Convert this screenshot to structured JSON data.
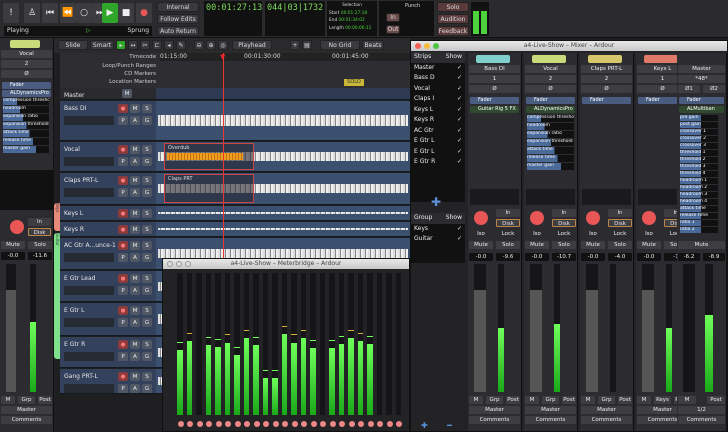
{
  "transport": {
    "status_left": "Playing",
    "status_right": "Sprung",
    "sync": "Internal",
    "follow_edits": "Follow Edits",
    "auto_return": "Auto Return",
    "icons": [
      "alert-icon",
      "metronome-icon",
      "goto-start-icon",
      "goto-prev-icon",
      "loop-icon",
      "goto-end-icon",
      "play-icon",
      "stop-icon",
      "record-icon"
    ]
  },
  "clocks": {
    "primary": "00:01:27:13",
    "secondary": "044|03|1732"
  },
  "selection": {
    "title": "Selection",
    "start_label": "Start",
    "start": "00:01:27:18",
    "end_label": "End",
    "end": "00:01:34:02",
    "length_label": "Length",
    "length": "00:00:06:11"
  },
  "punch": {
    "title": "Punch",
    "in": "In",
    "out": "Out"
  },
  "monitor": {
    "solo": "Solo",
    "audition": "Audition",
    "feedback": "Feedback"
  },
  "toolbar": {
    "edit_mode": "Slide",
    "tool_mode": "Smart",
    "edit_point": "Playhead",
    "grid": "No Grid",
    "beats": "Beats"
  },
  "ruler": {
    "rows": [
      "Timecode",
      "Loop/Punch Ranges",
      "CD Markers",
      "Location Markers"
    ],
    "ticks": [
      "01:15:00",
      "00:01:30:00",
      "00:01:45:00"
    ],
    "marker": "SOLO"
  },
  "editor_strip": {
    "name": "Vocal",
    "input": "2",
    "phase": "Ø",
    "plugins": [
      "Fader",
      "ALDynamicsPro"
    ],
    "params": [
      "compression threshold",
      "headroom",
      "expansion ratio",
      "expansion threshold",
      "attack time",
      "release time",
      "master gain"
    ],
    "in": "In",
    "disk": "Disk",
    "mute": "Mute",
    "solo": "Solo",
    "gain": "-0.0",
    "peak": "-11.6",
    "level": 0.55,
    "m": "M",
    "grp": "Grp",
    "post": "Post",
    "output": "Master",
    "comments": "Comments"
  },
  "tracks": [
    {
      "name": "Master",
      "type": "master"
    },
    {
      "name": "Bass DI",
      "h": 40
    },
    {
      "name": "Vocal",
      "h": 30,
      "region": "Overdub"
    },
    {
      "name": "Claps PRT-L",
      "h": 32,
      "region": "Claps PRT"
    },
    {
      "name": "Keys L",
      "h": 15,
      "small": true
    },
    {
      "name": "Keys R",
      "h": 15,
      "small": true
    },
    {
      "name": "AC Gtr A...unce-1",
      "h": 32
    },
    {
      "name": "E Gtr Lead",
      "h": 31
    },
    {
      "name": "E Gtr L",
      "h": 33
    },
    {
      "name": "E Gtr R",
      "h": 31
    },
    {
      "name": "Gang PRT-L",
      "h": 25
    }
  ],
  "groups_tabs": [
    "Keys",
    "Guitar"
  ],
  "track_buttons": {
    "m": "M",
    "s": "S",
    "p": "P",
    "a": "A",
    "g": "G"
  },
  "mixer": {
    "title": "a4-Live-Show – Mixer – Ardour",
    "strips_header": [
      "Strips",
      "Show"
    ],
    "strips_list": [
      "Master",
      "Bass D",
      "Vocal",
      "Claps I",
      "Keys L",
      "Keys R",
      "AC Gtr",
      "E Gtr L",
      "E Gtr L",
      "E Gtr R"
    ],
    "group_header": [
      "Group",
      "Show"
    ],
    "groups": [
      "Keys",
      "Guitar"
    ],
    "check": "✓",
    "strips": [
      {
        "name": "Bass DI",
        "color": "#7fd0cc",
        "input": "1",
        "plugins": [
          "Fader",
          "Guitar Rig 5 FX"
        ],
        "gain": "-0.0",
        "peak": "-9.6",
        "level": 0.5,
        "grp": "Grp",
        "output": "Master"
      },
      {
        "name": "Vocal",
        "color": "#c9da7a",
        "input": "2",
        "plugins": [
          "Fader",
          "ALDynamicsPro"
        ],
        "gain": "-0.0",
        "peak": "-10.7",
        "level": 0.53,
        "grp": "Grp",
        "output": "Master"
      },
      {
        "name": "Claps PRT-L",
        "color": "#d6c66c",
        "input": "2",
        "plugins": [
          "Fader"
        ],
        "gain": "-0.0",
        "peak": "-4.0",
        "level": 0,
        "grp": "Grp",
        "output": "Master"
      },
      {
        "name": "Keys L",
        "color": "#e07a68",
        "input": "1",
        "plugins": [
          "Fader"
        ],
        "gain": "-0.0",
        "peak": "-1",
        "level": 0.5,
        "grp": "Keys",
        "output": "Master"
      }
    ],
    "params": [
      "compression threshold",
      "headroom",
      "expansion ratio",
      "expansion threshold",
      "attack time",
      "release time",
      "master gain"
    ],
    "labels": {
      "in": "In",
      "disk": "Disk",
      "iso": "Iso",
      "lock": "Lock",
      "mute": "Mute",
      "solo": "Solo",
      "m": "M",
      "post": "Post",
      "comments": "Comments",
      "phase": "Ø"
    },
    "master": {
      "name": "Master",
      "input": "*48*",
      "phase1": "Ø1",
      "phase2": "Ø2",
      "plugins": [
        "Fader",
        "ALMultiban"
      ],
      "params": [
        "pre gain",
        "post gain",
        "crossover 1",
        "crossover 2",
        "crossover 3",
        "threshold 1",
        "threshold 2",
        "threshold 3",
        "threshold 4",
        "headroom 1",
        "headroom 2",
        "headroom 3",
        "headroom 4",
        "attack time",
        "release time",
        "ratio 1",
        "ratio 2"
      ],
      "mute": "Mute",
      "gain": "-6.2",
      "peak": "-8.9",
      "level": 0.6,
      "output": "1/2"
    }
  },
  "meterbridge": {
    "title": "a4-Live-Show – Meterbridge – Ardour",
    "levels": [
      0.46,
      0.52,
      0,
      0.49,
      0.48,
      0.51,
      0.42,
      0.54,
      0.49,
      0.26,
      0.26,
      0.57,
      0.51,
      0.54,
      0.47,
      0,
      0.47,
      0.5,
      0.54,
      0.52,
      0.5,
      0,
      0,
      0
    ]
  },
  "colors": {
    "accent_green": "#4cd23a",
    "record": "#e85656",
    "track_bg": "#34415c"
  }
}
